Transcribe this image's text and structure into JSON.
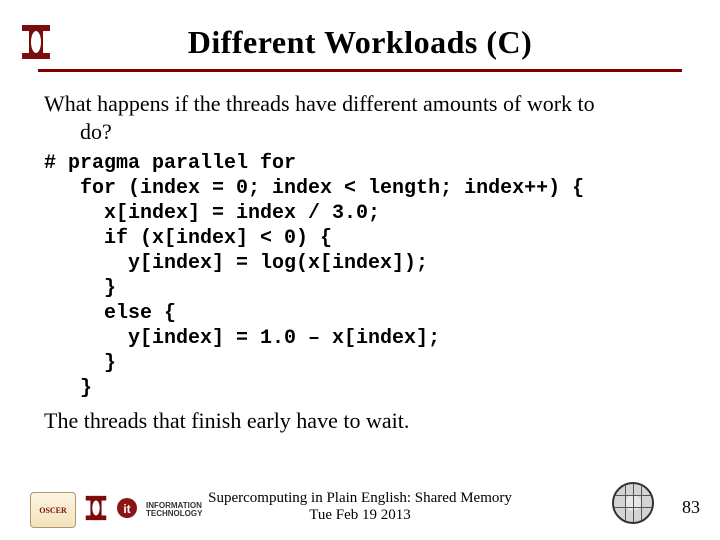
{
  "title": "Different Workloads (C)",
  "intro_line1": "What happens if the threads have different amounts of work to",
  "intro_line2": "do?",
  "code": "# pragma parallel for\n   for (index = 0; index < length; index++) {\n     x[index] = index / 3.0;\n     if (x[index] < 0) {\n       y[index] = log(x[index]);\n     }\n     else {\n       y[index] = 1.0 – x[index];\n     }\n   }",
  "conclusion": "The threads that finish early have to wait.",
  "footer_line1": "Supercomputing in Plain English: Shared Memory",
  "footer_line2": "Tue Feb 19 2013",
  "page_number": "83",
  "logos": {
    "ou": "OU",
    "oscer": "OSCER",
    "it_line1": "INFORMATION",
    "it_line2": "TECHNOLOGY"
  }
}
